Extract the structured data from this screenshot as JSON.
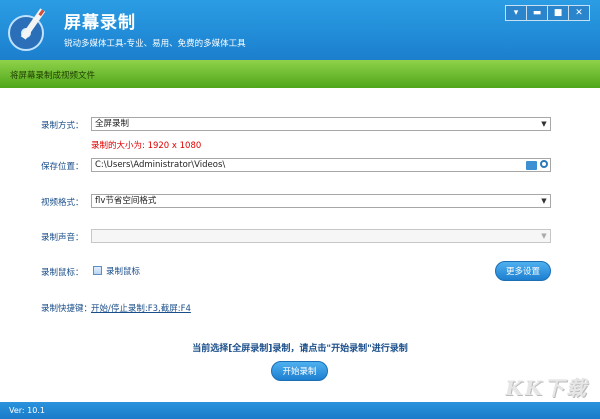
{
  "header": {
    "title": "屏幕录制",
    "subtitle": "锐动多媒体工具-专业、易用、免费的多媒体工具",
    "controls": [
      "▾",
      "▬",
      "■",
      "✕"
    ]
  },
  "banner": {
    "text": "将屏幕录制成视频文件"
  },
  "form": {
    "record_mode_label": "录制方式：",
    "record_mode_value": "全屏录制",
    "size_hint": "录制的大小为: 1920 x 1080",
    "save_location_label": "保存位置：",
    "save_location_value": "C:\\Users\\Administrator\\Videos\\",
    "video_format_label": "视频格式：",
    "video_format_value": "flv节省空间格式",
    "audio_label": "录制声音：",
    "audio_value": "",
    "mouse_label": "录制鼠标：",
    "mouse_checkbox_label": "录制鼠标",
    "more_settings": "更多设置",
    "hotkey_label": "录制快捷键：",
    "hotkey_value": "开始/停止录制:F3,截屏:F4"
  },
  "status": {
    "message": "当前选择[全屏录制]录制，请点击\"开始录制\"进行录制",
    "start_button": "开始录制"
  },
  "footer": {
    "version": "Ver: 10.1"
  },
  "watermark": {
    "text": "KK下载"
  },
  "colors": {
    "header_blue": "#1b7fce",
    "banner_green": "#5bb022",
    "hint_red": "#e00000",
    "label_blue": "#1a4e8a"
  }
}
